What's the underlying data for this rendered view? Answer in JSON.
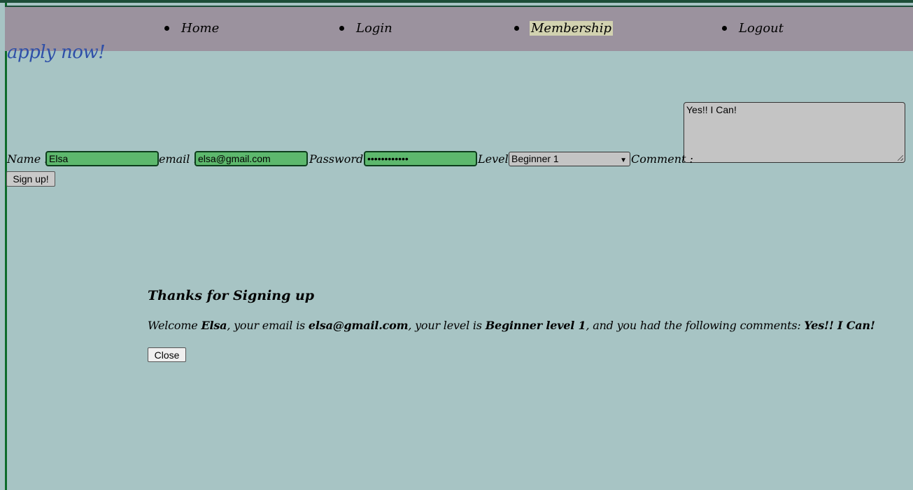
{
  "nav": {
    "items": [
      {
        "label": "Home"
      },
      {
        "label": "Login"
      },
      {
        "label": "Membership"
      },
      {
        "label": "Logout"
      }
    ]
  },
  "heading": "apply now!",
  "form": {
    "name_label": "Name :",
    "name_value": "Elsa",
    "email_label": "email :",
    "email_value": "elsa@gmail.com",
    "password_label": "Password :",
    "password_value": "••••••••••••",
    "level_label": "Level :",
    "level_value": "Beginner 1",
    "comment_label": "Comment :",
    "comment_value": "Yes!! I Can!",
    "submit_label": "Sign up!"
  },
  "thanks": {
    "title": "Thanks for Signing up",
    "welcome": "Welcome ",
    "name": "Elsa",
    "email_prefix": ", your email is ",
    "email": "elsa@gmail.com",
    "level_prefix": ", your level is ",
    "level": "Beginner level 1",
    "comment_prefix": ", and you had the following comments: ",
    "comment": "Yes!! I Can!",
    "close_label": "Close"
  },
  "colors": {
    "background": "#a7c4c4",
    "nav_background": "#9b929e",
    "active_highlight": "#d2d2b0",
    "heading": "#2e4fa8",
    "input_fill": "#5db86d"
  }
}
